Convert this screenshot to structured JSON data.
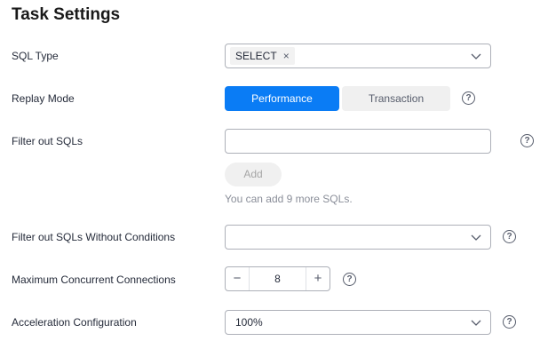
{
  "page": {
    "title": "Task Settings"
  },
  "sql_type": {
    "label": "SQL Type",
    "selected_tag": "SELECT",
    "remove_glyph": "×"
  },
  "replay_mode": {
    "label": "Replay Mode",
    "options": [
      "Performance",
      "Transaction"
    ],
    "selected": "Performance"
  },
  "filter_sqls": {
    "label": "Filter out SQLs",
    "value": "",
    "add_label": "Add",
    "hint": "You can add 9 more SQLs."
  },
  "filter_no_cond": {
    "label": "Filter out SQLs Without Conditions",
    "value": ""
  },
  "max_conn": {
    "label": "Maximum Concurrent Connections",
    "value": "8",
    "minus": "−",
    "plus": "+"
  },
  "accel": {
    "label": "Acceleration Configuration",
    "value": "100%"
  },
  "help_glyph": "?",
  "colors": {
    "accent": "#0a7cf5",
    "text": "#252b3a",
    "border": "#adb0b8",
    "muted": "#8a8e99"
  }
}
